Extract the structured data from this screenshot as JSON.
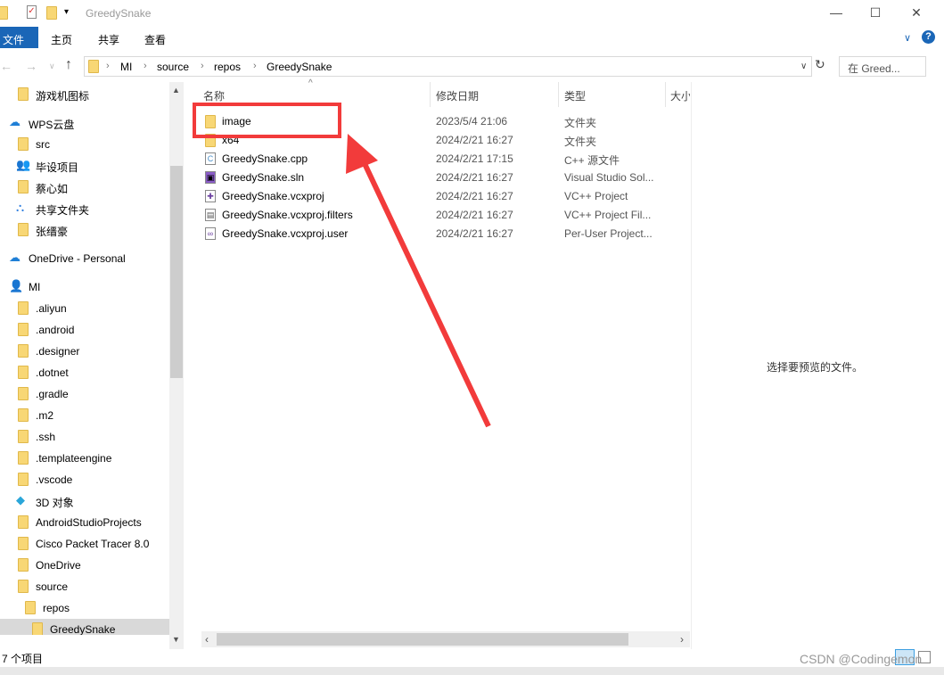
{
  "window": {
    "title": "GreedySnake",
    "minimize": "—",
    "maximize": "☐",
    "close": "✕"
  },
  "ribbon": {
    "tabs": [
      "文件",
      "主页",
      "共享",
      "查看"
    ],
    "help": "?",
    "expand": "∨"
  },
  "nav": {
    "back": "←",
    "forward": "→",
    "recent": "∨",
    "up": "↑",
    "crumbs": [
      "MI",
      "source",
      "repos",
      "GreedySnake"
    ],
    "dropdown": "∨",
    "refresh": "↻",
    "search_placeholder": "在 Greed..."
  },
  "sidebar": {
    "items": [
      {
        "label": "游戏机图标",
        "icon": "folder"
      },
      {
        "label": "WPS云盘",
        "icon": "cloud"
      },
      {
        "label": "src",
        "icon": "folder"
      },
      {
        "label": "毕设项目",
        "icon": "shared-users"
      },
      {
        "label": "蔡心如",
        "icon": "folder"
      },
      {
        "label": "共享文件夹",
        "icon": "share"
      },
      {
        "label": "张缙豪",
        "icon": "folder"
      },
      {
        "label": "OneDrive - Personal",
        "icon": "cloud"
      },
      {
        "label": "MI",
        "icon": "user"
      },
      {
        "label": ".aliyun",
        "icon": "folder"
      },
      {
        "label": ".android",
        "icon": "folder"
      },
      {
        "label": ".designer",
        "icon": "folder"
      },
      {
        "label": ".dotnet",
        "icon": "folder"
      },
      {
        "label": ".gradle",
        "icon": "folder"
      },
      {
        "label": ".m2",
        "icon": "folder"
      },
      {
        "label": ".ssh",
        "icon": "folder"
      },
      {
        "label": ".templateengine",
        "icon": "folder"
      },
      {
        "label": ".vscode",
        "icon": "folder"
      },
      {
        "label": "3D 对象",
        "icon": "cube"
      },
      {
        "label": "AndroidStudioProjects",
        "icon": "folder"
      },
      {
        "label": "Cisco Packet Tracer 8.0",
        "icon": "folder"
      },
      {
        "label": "OneDrive",
        "icon": "folder"
      },
      {
        "label": "source",
        "icon": "folder"
      },
      {
        "label": "repos",
        "icon": "folder"
      },
      {
        "label": "GreedySnake",
        "icon": "folder",
        "selected": true
      }
    ]
  },
  "columns": [
    "名称",
    "修改日期",
    "类型",
    "大小"
  ],
  "files": [
    {
      "name": "image",
      "date": "2023/5/4 21:06",
      "type": "文件夹",
      "icon": "folder"
    },
    {
      "name": "x64",
      "date": "2024/2/21 16:27",
      "type": "文件夹",
      "icon": "folder"
    },
    {
      "name": "GreedySnake.cpp",
      "date": "2024/2/21 17:15",
      "type": "C++ 源文件",
      "icon": "cpp-file"
    },
    {
      "name": "GreedySnake.sln",
      "date": "2024/2/21 16:27",
      "type": "Visual Studio Sol...",
      "icon": "vs-solution"
    },
    {
      "name": "GreedySnake.vcxproj",
      "date": "2024/2/21 16:27",
      "type": "VC++ Project",
      "icon": "vcxproj"
    },
    {
      "name": "GreedySnake.vcxproj.filters",
      "date": "2024/2/21 16:27",
      "type": "VC++ Project Fil...",
      "icon": "filters-file"
    },
    {
      "name": "GreedySnake.vcxproj.user",
      "date": "2024/2/21 16:27",
      "type": "Per-User Project...",
      "icon": "user-file"
    }
  ],
  "preview_text": "选择要预览的文件。",
  "status": "7 个项目",
  "watermark": "CSDN @Codingemon",
  "annotation_color": "#f23b3b"
}
